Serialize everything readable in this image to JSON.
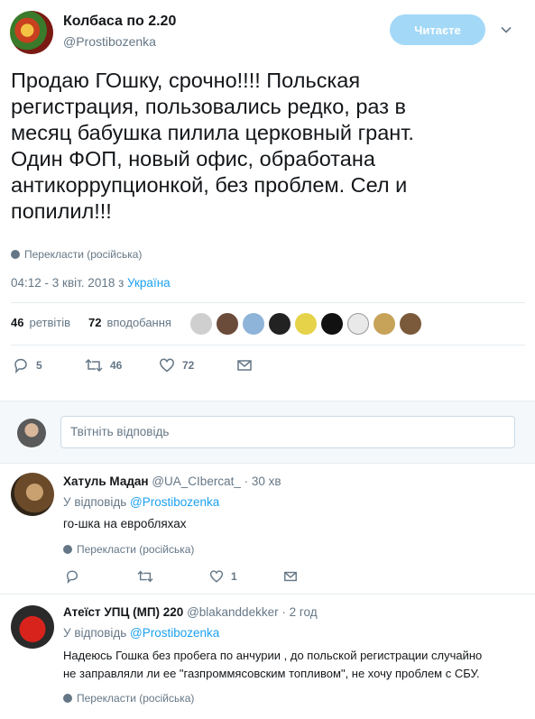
{
  "tweet": {
    "author_name": "Колбаса по 2.20",
    "author_handle": "@Prostibozenka",
    "follow_label": "Читаєте",
    "text_lines": [
      "Продаю ГОшку, срочно!!!! Польская",
      "регистрация, пользовались редко, раз в",
      "месяц бабушка пилила церковный грант.",
      "Один ФОП, новый офис,  обработана",
      "антикоррупционкой, без проблем. Сел и",
      "попилил!!!"
    ],
    "translate_label": "Перекласти (російська)",
    "time": "04:12 - 3 квіт. 2018 з",
    "location": "Україна",
    "retweets_count": "46",
    "retweets_label": "ретвітів",
    "likes_count": "72",
    "likes_label": "вподобання",
    "reply_count": "5",
    "retweet_count": "46",
    "like_count": "72"
  },
  "compose": {
    "placeholder": "Твітніть відповідь"
  },
  "replies": [
    {
      "name": "Хатуль Мадан",
      "handle": "@UA_CIbercat_",
      "age": "30 хв",
      "reply_to_label": "У відповідь",
      "reply_to_handle": "@Prostibozenka",
      "text": "го-шка на евробляхах",
      "translate_label": "Перекласти (російська)",
      "like_count": "1"
    },
    {
      "name": "Атеїст УПЦ (МП) 220",
      "handle": "@blakanddekker",
      "age": "2 год",
      "reply_to_label": "У відповідь",
      "reply_to_handle": "@Prostibozenka",
      "text_lines": [
        "Надеюсь Гошка без пробега по анчурии , до польской регистрации случайно",
        "не заправляли ли ее \"газпроммясовским топливом\", не хочу проблем с СБУ."
      ],
      "translate_label": "Перекласти (російська)"
    }
  ],
  "colors": {
    "accent": "#1da1f2",
    "muted": "#657786",
    "follow_button": "#a3d8f7"
  }
}
